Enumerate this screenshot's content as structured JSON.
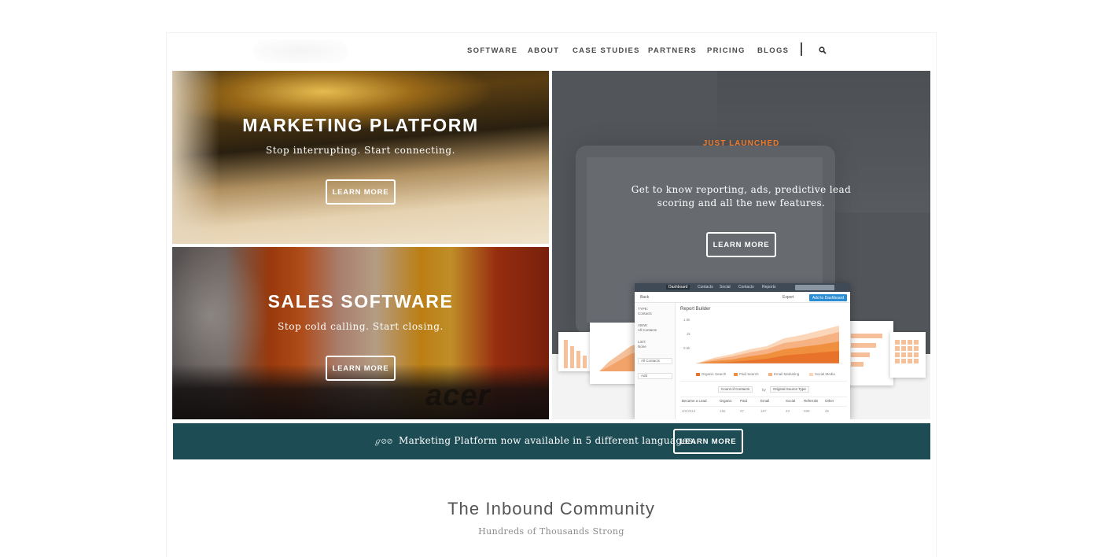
{
  "nav": {
    "items": [
      "SOFTWARE",
      "ABOUT",
      "CASE STUDIES",
      "PARTNERS",
      "PRICING",
      "BLOGS"
    ],
    "search_icon": "search-icon"
  },
  "tiles": {
    "marketing": {
      "title": "MARKETING PLATFORM",
      "subtitle": "Stop interrupting. Start connecting.",
      "button": "LEARN MORE"
    },
    "sales": {
      "title": "SALES SOFTWARE",
      "subtitle": "Stop cold calling. Start closing.",
      "button": "LEARN MORE",
      "photo_brand": "acer"
    },
    "launch": {
      "kicker": "JUST LAUNCHED",
      "text": "Get to know reporting, ads, predictive lead scoring and all the new features.",
      "button": "LEARN MORE",
      "kicker_color": "#f07a2a"
    }
  },
  "mock_app": {
    "tabs": [
      "Dashboard",
      "Contacts",
      "Social",
      "Contacts",
      "Reports"
    ],
    "back": "Back",
    "export": "Export",
    "add_button": "Add to Dashboard",
    "title": "Report Builder",
    "sidebar": [
      {
        "label": "TYPE:",
        "value": "Contacts"
      },
      {
        "label": "VIEW:",
        "value": "All Contacts"
      },
      {
        "label": "LIST:",
        "value": "None"
      }
    ],
    "sidebar_box_1": "All Contacts",
    "sidebar_box_2": "Add",
    "y_ticks": [
      "1.5k",
      "1k",
      "0.5k"
    ],
    "legend": [
      "Organic Search",
      "Paid Search",
      "Email Marketing",
      "Social Media"
    ],
    "select_1": "Count of Contacts",
    "by": "by",
    "select_2": "Original Source Type",
    "table_headers": [
      "Became a Lead",
      "Organic",
      "Paid",
      "Email",
      "Social",
      "Referrals",
      "Other"
    ],
    "table_row": [
      "3/2/2014",
      "156",
      "27",
      "187",
      "43",
      "288",
      "45"
    ]
  },
  "banner": {
    "mark": "ℊ⊘⊘",
    "text": "Marketing Platform now available in 5 different languages.",
    "button": "LEARN MORE",
    "color": "#1d4c55"
  },
  "community": {
    "title": "The Inbound Community",
    "subtitle": "Hundreds of Thousands Strong"
  }
}
